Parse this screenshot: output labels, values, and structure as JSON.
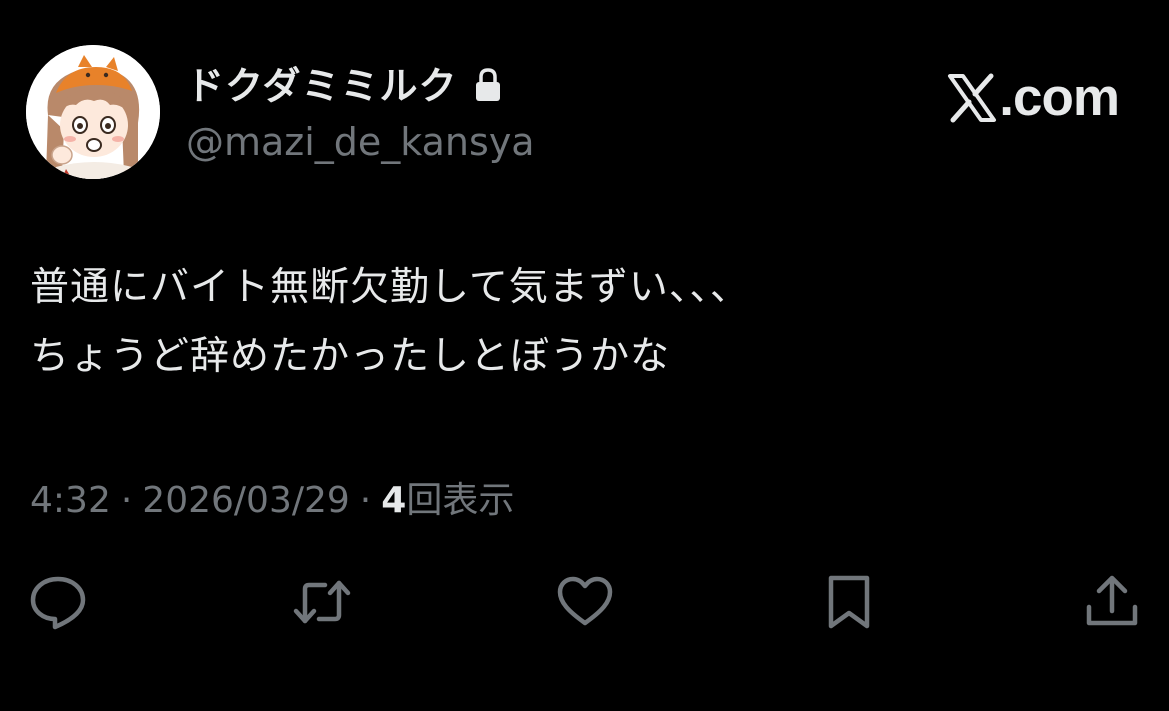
{
  "author": {
    "display_name": "ドクダミミルク",
    "handle": "@mazi_de_kansya",
    "avatar_icon": "avatar-illustration",
    "protected_icon": "lock-icon"
  },
  "brand": {
    "icon": "x-logo-icon",
    "text": ".com"
  },
  "post": {
    "lines": [
      "普通にバイト無断欠勤して気まずい、、、",
      "ちょうど辞めたかったしとぼうかな"
    ]
  },
  "meta": {
    "time": "4:32",
    "separator": "·",
    "date": "2026/03/29",
    "views_count": "4",
    "views_label": "回表示"
  },
  "actions": [
    {
      "name": "reply",
      "icon": "reply-icon"
    },
    {
      "name": "repost",
      "icon": "repost-icon"
    },
    {
      "name": "like",
      "icon": "heart-icon"
    },
    {
      "name": "bookmark",
      "icon": "bookmark-icon"
    },
    {
      "name": "share",
      "icon": "share-icon"
    }
  ],
  "colors": {
    "background": "#000000",
    "primary_text": "#e7e9ea",
    "secondary_text": "#71767b",
    "icon": "#71767b"
  }
}
